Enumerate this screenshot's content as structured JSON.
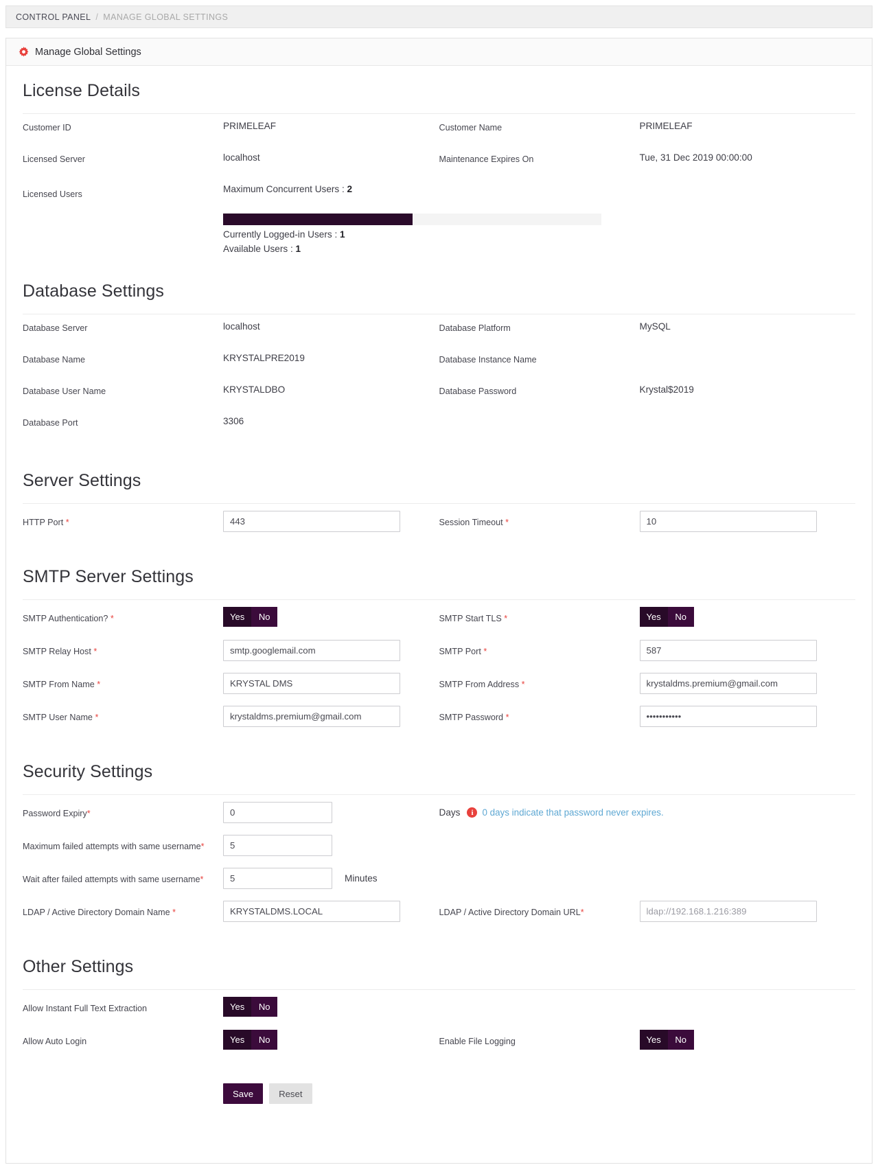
{
  "breadcrumb": {
    "root": "CONTROL PANEL",
    "separator": "/",
    "current": "MANAGE GLOBAL SETTINGS"
  },
  "panel": {
    "title": "Manage Global Settings",
    "icon": "gear-icon"
  },
  "license": {
    "title": "License Details",
    "customer_id_label": "Customer ID",
    "customer_id_value": "PRIMELEAF",
    "customer_name_label": "Customer Name",
    "customer_name_value": "PRIMELEAF",
    "licensed_server_label": "Licensed Server",
    "licensed_server_value": "localhost",
    "maintenance_label": "Maintenance Expires On",
    "maintenance_value": "Tue, 31 Dec 2019 00:00:00",
    "licensed_users_label": "Licensed Users",
    "max_concurrent_text": "Maximum Concurrent Users : ",
    "max_concurrent_value": "2",
    "logged_in_text": "Currently Logged-in Users : ",
    "logged_in_value": "1",
    "available_text": "Available Users : ",
    "available_value": "1",
    "progress_percent": "50%"
  },
  "database": {
    "title": "Database Settings",
    "server_label": "Database Server",
    "server_value": "localhost",
    "platform_label": "Database Platform",
    "platform_value": "MySQL",
    "name_label": "Database Name",
    "name_value": "KRYSTALPRE2019",
    "instance_label": "Database Instance Name",
    "instance_value": "",
    "user_label": "Database User Name",
    "user_value": "KRYSTALDBO",
    "password_label": "Database Password",
    "password_value": "Krystal$2019",
    "port_label": "Database Port",
    "port_value": "3306"
  },
  "server": {
    "title": "Server Settings",
    "http_port_label": "HTTP Port ",
    "http_port_value": "443",
    "session_timeout_label": "Session Timeout ",
    "session_timeout_value": "10"
  },
  "smtp": {
    "title": "SMTP Server Settings",
    "auth_label": "SMTP Authentication? ",
    "auth_yes": "Yes",
    "auth_no": "No",
    "auth_selected": "Yes",
    "tls_label": "SMTP Start TLS ",
    "tls_yes": "Yes",
    "tls_no": "No",
    "tls_selected": "Yes",
    "relay_host_label": "SMTP Relay Host ",
    "relay_host_value": "smtp.googlemail.com",
    "port_label": "SMTP Port ",
    "port_value": "587",
    "from_name_label": "SMTP From Name ",
    "from_name_value": "KRYSTAL DMS",
    "from_address_label": "SMTP From Address ",
    "from_address_value": "krystaldms.premium@gmail.com",
    "user_name_label": "SMTP User Name ",
    "user_name_value": "krystaldms.premium@gmail.com",
    "password_label": "SMTP Password ",
    "password_value": "•••••••••••"
  },
  "security": {
    "title": "Security Settings",
    "password_expiry_label": "Password Expiry",
    "password_expiry_value": "0",
    "days_unit": "Days",
    "days_info": "0 days indicate that password never expires.",
    "info_icon_glyph": "i",
    "max_failed_label": "Maximum failed attempts with same username",
    "max_failed_value": "5",
    "wait_failed_label": "Wait after failed attempts with same username",
    "wait_failed_value": "5",
    "minutes_unit": "Minutes",
    "ldap_name_label": "LDAP / Active Directory Domain Name ",
    "ldap_name_value": "KRYSTALDMS.LOCAL",
    "ldap_url_label": "LDAP / Active Directory Domain URL",
    "ldap_url_placeholder": "ldap://192.168.1.216:389",
    "ldap_url_value": ""
  },
  "other": {
    "title": "Other Settings",
    "full_text_label": "Allow Instant Full Text Extraction",
    "full_text_yes": "Yes",
    "full_text_no": "No",
    "full_text_selected": "Yes",
    "auto_login_label": "Allow Auto Login",
    "auto_login_yes": "Yes",
    "auto_login_no": "No",
    "auto_login_selected": "Yes",
    "file_logging_label": "Enable File Logging",
    "file_logging_yes": "Yes",
    "file_logging_no": "No",
    "file_logging_selected": "Yes"
  },
  "actions": {
    "save_label": "Save",
    "reset_label": "Reset"
  },
  "colors": {
    "accent_dark": "#280a28",
    "accent": "#3b0b3b",
    "required": "#e8413c",
    "info_text": "#5fa8d3"
  }
}
